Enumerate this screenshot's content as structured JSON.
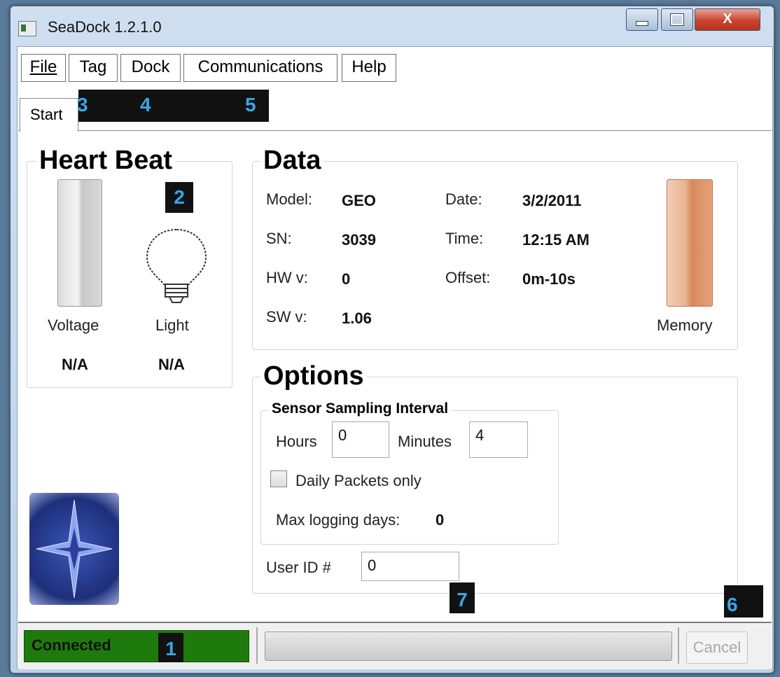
{
  "window": {
    "title": "SeaDock 1.2.1.0",
    "close_glyph": "X"
  },
  "menu": [
    "File",
    "Tag",
    "Dock",
    "Communications",
    "Help"
  ],
  "tabs": {
    "active": "Start"
  },
  "annotations": [
    "1",
    "2",
    "3",
    "4",
    "5",
    "6",
    "7"
  ],
  "heartbeat": {
    "title": "Heart Beat",
    "voltage": {
      "label": "Voltage",
      "value": "N/A"
    },
    "light": {
      "label": "Light",
      "value": "N/A"
    }
  },
  "data": {
    "title": "Data",
    "model_label": "Model:",
    "model": "GEO",
    "sn_label": "SN:",
    "sn": "3039",
    "hw_label": "HW v:",
    "hw": "0",
    "sw_label": "SW v:",
    "sw": "1.06",
    "date_label": "Date:",
    "date": "3/2/2011",
    "time_label": "Time:",
    "time": "12:15 AM",
    "offset_label": "Offset:",
    "offset": "0m-10s",
    "memory_label": "Memory"
  },
  "options": {
    "title": "Options",
    "sampling_title": "Sensor Sampling Interval",
    "hours_label": "Hours",
    "hours": "0",
    "minutes_label": "Minutes",
    "minutes": "4",
    "daily_label": "Daily Packets only",
    "daily_checked": false,
    "max_days_label": "Max logging days:",
    "max_days": "0",
    "userid_label": "User ID #",
    "userid": "0"
  },
  "status": {
    "text": "Connected",
    "cancel_label": "Cancel",
    "colors": {
      "connected": "#1f7a0e"
    }
  },
  "colors": {
    "memory_bar": "#d88a5c",
    "accent_annotation": "#35a7e8"
  }
}
